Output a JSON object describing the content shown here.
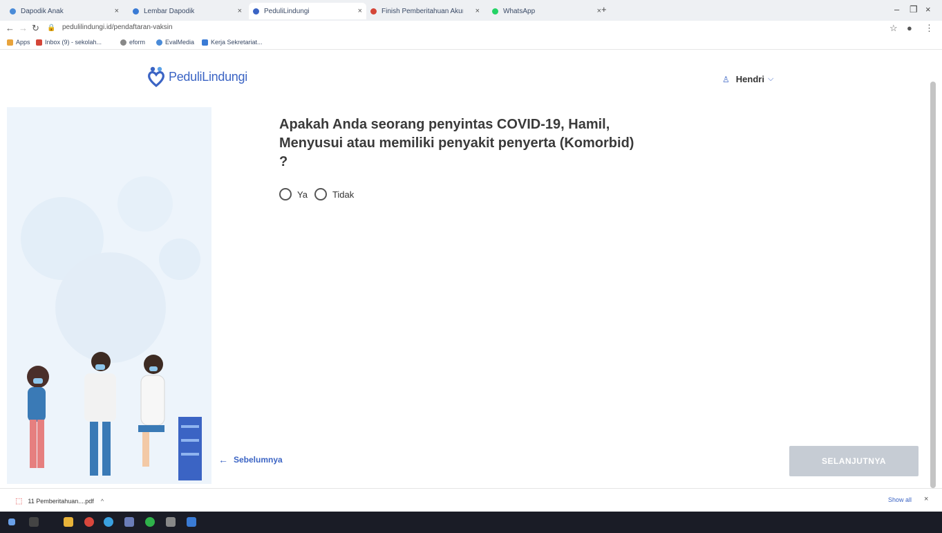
{
  "browser": {
    "tabs": [
      {
        "label": "Dapodik Anak",
        "color": "#4a8bd8"
      },
      {
        "label": "Lembar Dapodik",
        "color": "#3a7bd5"
      },
      {
        "label": "PeduliLindungi",
        "color": "#3b64c4"
      },
      {
        "label": "Finish Pemberitahuan Akun Hary",
        "color": "#d44638"
      },
      {
        "label": "WhatsApp",
        "color": "#25d366"
      }
    ],
    "url": "pedulilindungi.id/pendaftaran-vaksin",
    "bookmarks": [
      {
        "label": "Apps"
      },
      {
        "label": "Inbox (9) - sekolah..."
      },
      {
        "label": "eform"
      },
      {
        "label": "EvalMedia"
      },
      {
        "label": "Kerja Sekretariat..."
      }
    ]
  },
  "header": {
    "logo_text": "PeduliLindungi",
    "user_name": "Hendri"
  },
  "main": {
    "question": "Apakah Anda seorang penyintas COVID-19, Hamil, Menyusui atau memiliki penyakit penyerta (Komorbid) ?",
    "options": {
      "yes": "Ya",
      "no": "Tidak"
    },
    "prev_label": "Sebelumnya",
    "next_label": "SELANJUTNYA"
  },
  "download_bar": {
    "file_name": "11 Pemberitahuan....pdf",
    "show_all": "Show all"
  },
  "colors": {
    "brand_blue": "#3b64c4",
    "disabled_button": "#c6ccd4",
    "panel_bg": "#edf4fb"
  }
}
